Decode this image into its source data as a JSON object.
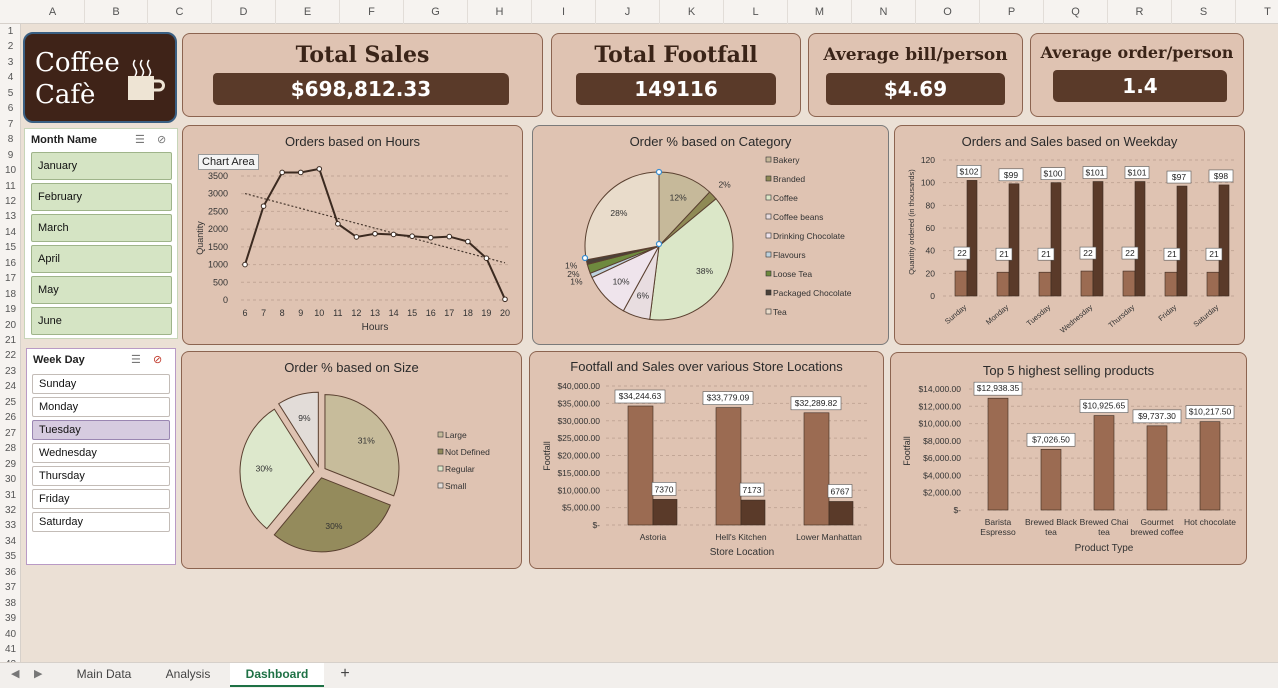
{
  "columns": [
    "A",
    "B",
    "C",
    "D",
    "E",
    "F",
    "G",
    "H",
    "I",
    "J",
    "K",
    "L",
    "M",
    "N",
    "O",
    "P",
    "Q",
    "R",
    "S",
    "T"
  ],
  "rows": [
    "1",
    "2",
    "3",
    "4",
    "5",
    "6",
    "7",
    "8",
    "9",
    "10",
    "11",
    "12",
    "13",
    "14",
    "15",
    "16",
    "17",
    "18",
    "19",
    "20",
    "21",
    "22",
    "23",
    "24",
    "25",
    "26",
    "27",
    "28",
    "29",
    "30",
    "31",
    "32",
    "33",
    "34",
    "35",
    "36",
    "37",
    "38",
    "39",
    "40",
    "41",
    "42"
  ],
  "logo": {
    "line1": "Coffee",
    "line2": "Cafè",
    "icon": "coffee-cup-icon"
  },
  "kpis": {
    "total_sales": {
      "title": "Total Sales",
      "value": "$698,812.33"
    },
    "total_footfall": {
      "title": "Total Footfall",
      "value": "149116"
    },
    "avg_bill": {
      "title": "Average bill/person",
      "value": "$4.69"
    },
    "avg_order": {
      "title": "Average order/person",
      "value": "1.4"
    }
  },
  "month_slicer": {
    "title": "Month Name",
    "items": [
      "January",
      "February",
      "March",
      "April",
      "May",
      "June"
    ]
  },
  "weekday_slicer": {
    "title": "Week Day",
    "items": [
      "Sunday",
      "Monday",
      "Tuesday",
      "Wednesday",
      "Thursday",
      "Friday",
      "Saturday"
    ],
    "selected": "Tuesday"
  },
  "tooltip": "Chart Area",
  "colors": {
    "dark": "#5a3a29",
    "mid": "#9b6b52",
    "bg": "#dfc3b2",
    "slicer_green": "#d5e4c4",
    "slicer_purple": "#d6cbe0"
  },
  "chart_data": [
    {
      "type": "line",
      "title": "Orders based on Hours",
      "xlabel": "Hours",
      "ylabel": "Quantity",
      "x": [
        6,
        7,
        8,
        9,
        10,
        11,
        12,
        13,
        14,
        15,
        16,
        17,
        18,
        19,
        20
      ],
      "values": [
        1000,
        2650,
        3600,
        3600,
        3700,
        2150,
        1780,
        1870,
        1850,
        1800,
        1760,
        1790,
        1650,
        1180,
        20
      ],
      "yticks": [
        "0",
        "500",
        "1000",
        "1500",
        "2000",
        "2500",
        "3000",
        "3500"
      ],
      "ylim": [
        0,
        3500
      ],
      "trendline": true
    },
    {
      "type": "pie",
      "title": "Order % based on Category",
      "slices": [
        {
          "name": "Bakery",
          "pct": 12,
          "label": "12%",
          "color": "#c6b99a"
        },
        {
          "name": "Branded",
          "pct": 2,
          "label": "2%",
          "color": "#8f8a55"
        },
        {
          "name": "Coffee",
          "pct": 38,
          "label": "38%",
          "color": "#dbe7c8"
        },
        {
          "name": "Coffee beans",
          "pct": 6,
          "label": "6%",
          "color": "#e8dde0"
        },
        {
          "name": "Drinking Chocolate",
          "pct": 10,
          "label": "10%",
          "color": "#efe4ec"
        },
        {
          "name": "Flavours",
          "pct": 1,
          "label": "1%",
          "color": "#bed2de"
        },
        {
          "name": "Loose Tea",
          "pct": 2,
          "label": "2%",
          "color": "#6e8a3e"
        },
        {
          "name": "Packaged Chocolate",
          "pct": 1,
          "label": "1%",
          "color": "#4a4038"
        },
        {
          "name": "Tea",
          "pct": 28,
          "label": "28%",
          "color": "#e9dccb"
        }
      ]
    },
    {
      "type": "bar",
      "title": "Orders and Sales based on Weekday",
      "ylabel": "Quantity ordered (in thousands)",
      "categories": [
        "Sunday",
        "Monday",
        "Tuesday",
        "Wednesday",
        "Thursday",
        "Friday",
        "Saturday"
      ],
      "series": [
        {
          "name": "Orders",
          "values": [
            22,
            21,
            21,
            22,
            22,
            21,
            21
          ],
          "labels": [
            "22",
            "21",
            "21",
            "22",
            "22",
            "21",
            "21"
          ]
        },
        {
          "name": "Sales",
          "values": [
            102,
            99,
            100,
            101,
            101,
            97,
            98
          ],
          "labels": [
            "$102",
            "$99",
            "$100",
            "$101",
            "$101",
            "$97",
            "$98"
          ]
        }
      ],
      "yticks": [
        "0",
        "20",
        "40",
        "60",
        "80",
        "100",
        "120"
      ],
      "ylim": [
        0,
        120
      ]
    },
    {
      "type": "pie",
      "title": "Order % based on Size",
      "slices": [
        {
          "name": "Large",
          "pct": 31,
          "label": "31%",
          "color": "#c7bc9b"
        },
        {
          "name": "Not Defined",
          "pct": 30,
          "label": "30%",
          "color": "#948b5c"
        },
        {
          "name": "Regular",
          "pct": 30,
          "label": "30%",
          "color": "#dde8cc"
        },
        {
          "name": "Small",
          "pct": 9,
          "label": "9%",
          "color": "#e2dcd8"
        }
      ]
    },
    {
      "type": "bar",
      "title": "Footfall and Sales over various Store Locations",
      "xlabel": "Store Location",
      "ylabel": "Footfall",
      "categories": [
        "Astoria",
        "Hell's Kitchen",
        "Lower Manhattan"
      ],
      "series": [
        {
          "name": "Sales",
          "values": [
            34244.63,
            33779.09,
            32289.82
          ],
          "labels": [
            "$34,244.63",
            "$33,779.09",
            "$32,289.82"
          ]
        },
        {
          "name": "Footfall",
          "values": [
            7370,
            7173,
            6767
          ],
          "labels": [
            "7370",
            "7173",
            "6767"
          ]
        }
      ],
      "yticks": [
        "$-",
        "$5,000.00",
        "$10,000.00",
        "$15,000.00",
        "$20,000.00",
        "$25,000.00",
        "$30,000.00",
        "$35,000.00",
        "$40,000.00"
      ],
      "ylim": [
        0,
        40000
      ]
    },
    {
      "type": "bar",
      "title": "Top 5 highest selling products",
      "xlabel": "Product Type",
      "ylabel": "Footfall",
      "categories": [
        "Barista Espresso",
        "Brewed Black tea",
        "Brewed Chai tea",
        "Gourmet brewed coffee",
        "Hot chocolate"
      ],
      "category_lines": [
        [
          "Barista",
          "Espresso"
        ],
        [
          "Brewed Black",
          "tea"
        ],
        [
          "Brewed Chai",
          "tea"
        ],
        [
          "Gourmet",
          "brewed coffee"
        ],
        [
          "Hot chocolate",
          ""
        ]
      ],
      "values": [
        12938.35,
        7026.5,
        10925.65,
        9737.3,
        10217.5
      ],
      "labels": [
        "$12,938.35",
        "$7,026.50",
        "$10,925.65",
        "$9,737.30",
        "$10,217.50"
      ],
      "yticks": [
        "$-",
        "$2,000.00",
        "$4,000.00",
        "$6,000.00",
        "$8,000.00",
        "$10,000.00",
        "$12,000.00",
        "$14,000.00"
      ],
      "ylim": [
        0,
        14000
      ]
    }
  ],
  "tabs": [
    {
      "label": "Main Data",
      "active": false
    },
    {
      "label": "Analysis",
      "active": false
    },
    {
      "label": "Dashboard",
      "active": true
    }
  ],
  "add_sheet": "+"
}
